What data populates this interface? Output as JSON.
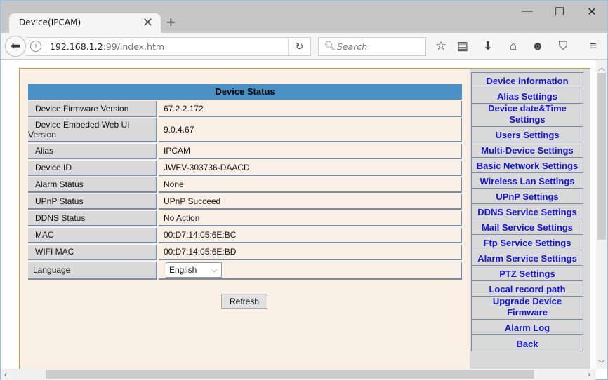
{
  "browser": {
    "tab_title": "Device(IPCAM)",
    "url_host": "192.168.1.2",
    "url_rest": ":99/index.htm",
    "search_placeholder": "Search"
  },
  "status": {
    "title": "Device Status",
    "rows": [
      {
        "label": "Device Firmware Version",
        "value": "67.2.2.172"
      },
      {
        "label": "Device Embeded Web UI Version",
        "value": "9.0.4.67"
      },
      {
        "label": "Alias",
        "value": "IPCAM"
      },
      {
        "label": "Device ID",
        "value": "JWEV-303736-DAACD"
      },
      {
        "label": "Alarm Status",
        "value": "None"
      },
      {
        "label": "UPnP Status",
        "value": "UPnP Succeed"
      },
      {
        "label": "DDNS Status",
        "value": "No Action"
      },
      {
        "label": "MAC",
        "value": "00:D7:14:05:6E:BC"
      },
      {
        "label": "WIFI MAC",
        "value": "00:D7:14:05:6E:BD"
      }
    ],
    "language_label": "Language",
    "language_value": "English",
    "refresh_label": "Refresh"
  },
  "menu": {
    "items": [
      {
        "label": "Device information"
      },
      {
        "label": "Alias Settings"
      },
      {
        "label": "Device date&Time Settings"
      },
      {
        "label": "Users Settings"
      },
      {
        "label": "Multi-Device Settings"
      },
      {
        "label": "Basic Network Settings"
      },
      {
        "label": "Wireless Lan Settings"
      },
      {
        "label": "UPnP Settings"
      },
      {
        "label": "DDNS Service Settings"
      },
      {
        "label": "Mail Service Settings"
      },
      {
        "label": "Ftp Service Settings"
      },
      {
        "label": "Alarm Service Settings"
      },
      {
        "label": "PTZ Settings"
      },
      {
        "label": "Local record path"
      },
      {
        "label": "Upgrade Device Firmware"
      },
      {
        "label": "Alarm Log"
      },
      {
        "label": "Back"
      }
    ]
  }
}
